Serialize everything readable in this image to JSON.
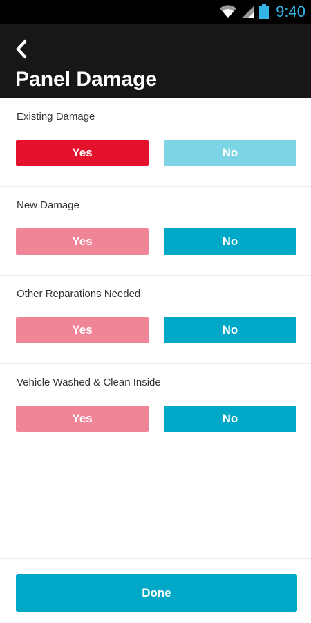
{
  "status_bar": {
    "time": "9:40",
    "icons": [
      "wifi-icon",
      "cell-signal-icon",
      "battery-icon"
    ],
    "accent": "#33b5e5"
  },
  "app_bar": {
    "back_icon": "chevron-left-icon",
    "title": "Panel Damage",
    "background": "#171717"
  },
  "colors": {
    "yes_active": "#e5122d",
    "yes_inactive": "#f08598",
    "no_active": "#00a8c8",
    "no_inactive": "#7dd4e4",
    "done": "#00a8c8"
  },
  "questions": [
    {
      "label": "Existing Damage",
      "yes_label": "Yes",
      "no_label": "No",
      "selected": "yes"
    },
    {
      "label": "New Damage",
      "yes_label": "Yes",
      "no_label": "No",
      "selected": "no"
    },
    {
      "label": "Other Reparations Needed",
      "yes_label": "Yes",
      "no_label": "No",
      "selected": "no"
    },
    {
      "label": "Vehicle Washed & Clean Inside",
      "yes_label": "Yes",
      "no_label": "No",
      "selected": "no"
    }
  ],
  "footer": {
    "done_label": "Done"
  }
}
